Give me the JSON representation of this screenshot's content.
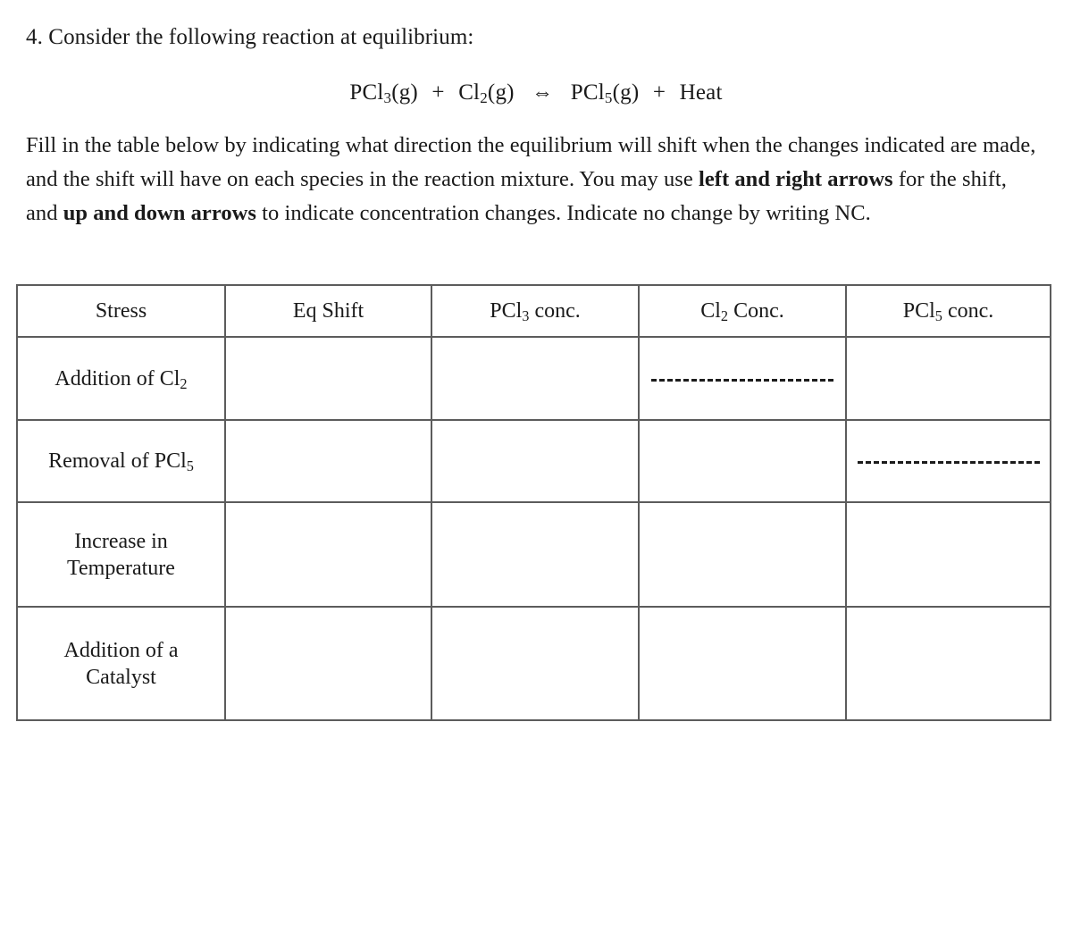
{
  "question": {
    "number": "4.",
    "heading": "4. Consider the following reaction at equilibrium:"
  },
  "equation": {
    "reactant_1": "PCl",
    "reactant_1_sub": "3",
    "reactant_1_state": "(g)",
    "plus_1": "+",
    "reactant_2": "Cl",
    "reactant_2_sub": "2",
    "reactant_2_state": "(g)",
    "arrow": "⇔",
    "product_1": "PCl",
    "product_1_sub": "5",
    "product_1_state": "(g)",
    "plus_2": "+",
    "product_2": "Heat",
    "full_text": "PCl3(g) + Cl2(g) ⇔ PCl5(g) + Heat"
  },
  "instructions": {
    "part_1": "Fill in the table below by indicating what direction the equilibrium will shift when the changes indicated are made, and the shift will have on each species in the reaction mixture. You may use ",
    "bold_1": "left and right arrows",
    "part_2": " for the shift, and ",
    "bold_2": "up and down arrows",
    "part_3": " to indicate concentration changes. Indicate no change by writing NC."
  },
  "table": {
    "headers": [
      {
        "label": "Stress",
        "sub": ""
      },
      {
        "label": "Eq Shift",
        "sub": ""
      },
      {
        "label_pre": "PCl",
        "sub": "3",
        "label_post": " conc."
      },
      {
        "label_pre": "Cl",
        "sub": "2",
        "label_post": " Conc."
      },
      {
        "label_pre": "PCl",
        "sub": "5",
        "label_post": " conc."
      }
    ],
    "header_plain": [
      "Stress",
      "Eq Shift",
      "PCl3 conc.",
      "Cl2 Conc.",
      "PCl5 conc."
    ],
    "rows": [
      {
        "stress_pre": "Addition of Cl",
        "stress_sub": "2",
        "stress_post": "",
        "stress_plain": "Addition of Cl2",
        "eq_shift": "",
        "pcl3": "",
        "cl2": "dashed-line",
        "pcl5": ""
      },
      {
        "stress_pre": "Removal of PCl",
        "stress_sub": "5",
        "stress_post": "",
        "stress_plain": "Removal of PCl5",
        "eq_shift": "",
        "pcl3": "",
        "cl2": "",
        "pcl5": "dashed-line"
      },
      {
        "stress_pre": "Increase in",
        "stress_sub": "",
        "stress_post": "Temperature",
        "stress_plain": "Increase in Temperature",
        "eq_shift": "",
        "pcl3": "",
        "cl2": "",
        "pcl5": ""
      },
      {
        "stress_pre": "Addition of a",
        "stress_sub": "",
        "stress_post": "Catalyst",
        "stress_plain": "Addition of a Catalyst",
        "eq_shift": "",
        "pcl3": "",
        "cl2": "",
        "pcl5": ""
      }
    ]
  },
  "colors": {
    "text": "#1a1a1a",
    "border": "#5c5c5c",
    "background": "#ffffff",
    "dash": "#1c1c1c"
  }
}
